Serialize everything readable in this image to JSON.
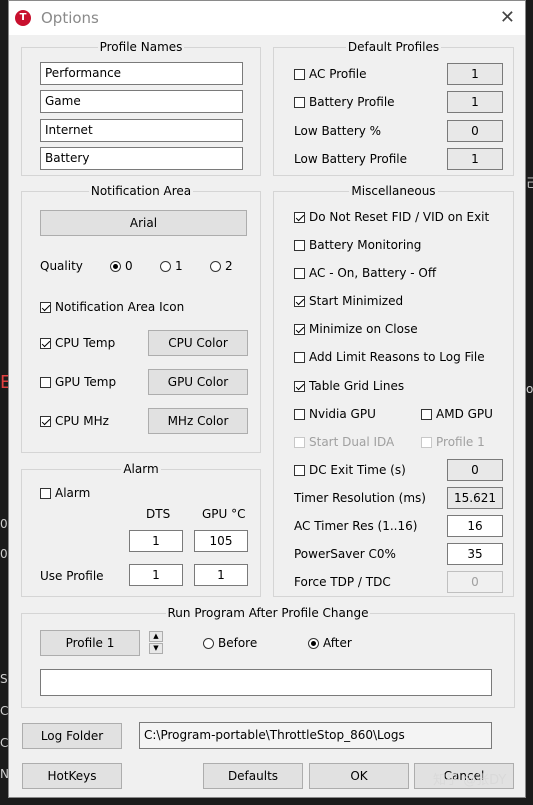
{
  "background_text": [
    "己",
    "E",
    "on",
    "0",
    "0",
    "S",
    "C",
    "C",
    "N"
  ],
  "window": {
    "title": "Options",
    "app_icon": "T",
    "close_icon": "✕"
  },
  "profile_names": {
    "title": "Profile Names",
    "items": [
      "Performance",
      "Game",
      "Internet",
      "Battery"
    ]
  },
  "default_profiles": {
    "title": "Default Profiles",
    "ac_profile": {
      "label": "AC Profile",
      "checked": false,
      "value": "1"
    },
    "battery_profile": {
      "label": "Battery Profile",
      "checked": false,
      "value": "1"
    },
    "low_battery_pct": {
      "label": "Low Battery %",
      "value": "0"
    },
    "low_battery_profile": {
      "label": "Low Battery Profile",
      "value": "1"
    }
  },
  "notification_area": {
    "title": "Notification Area",
    "font_button": "Arial",
    "quality_label": "Quality",
    "quality_options": [
      "0",
      "1",
      "2"
    ],
    "quality_selected": "0",
    "icon_checkbox": {
      "label": "Notification Area Icon",
      "checked": true
    },
    "cpu_temp": {
      "label": "CPU Temp",
      "checked": true,
      "button": "CPU Color"
    },
    "gpu_temp": {
      "label": "GPU Temp",
      "checked": false,
      "button": "GPU Color"
    },
    "cpu_mhz": {
      "label": "CPU MHz",
      "checked": true,
      "button": "MHz Color"
    }
  },
  "alarm": {
    "title": "Alarm",
    "alarm_checkbox": {
      "label": "Alarm",
      "checked": false
    },
    "col_dts": "DTS",
    "col_gpu": "GPU °C",
    "dts_value": "1",
    "gpu_value": "105",
    "use_profile_label": "Use Profile",
    "use_profile_dts": "1",
    "use_profile_gpu": "1"
  },
  "misc": {
    "title": "Miscellaneous",
    "checks": [
      {
        "label": "Do Not Reset FID / VID on Exit",
        "checked": true
      },
      {
        "label": "Battery Monitoring",
        "checked": false
      },
      {
        "label": "AC - On, Battery - Off",
        "checked": false
      },
      {
        "label": "Start Minimized",
        "checked": true
      },
      {
        "label": "Minimize on Close",
        "checked": true
      },
      {
        "label": "Add Limit Reasons to Log File",
        "checked": false
      },
      {
        "label": "Table Grid Lines",
        "checked": true
      }
    ],
    "nvidia_gpu": {
      "label": "Nvidia GPU",
      "checked": false
    },
    "amd_gpu": {
      "label": "AMD GPU",
      "checked": false
    },
    "start_dual_ida": {
      "label": "Start Dual IDA",
      "checked": false
    },
    "profile_1": {
      "label": "Profile 1",
      "checked": false
    },
    "dc_exit_time": {
      "label": "DC Exit Time (s)",
      "checked": false,
      "value": "0"
    },
    "timer_resolution": {
      "label": "Timer Resolution (ms)",
      "value": "15.621"
    },
    "ac_timer_res": {
      "label": "AC Timer Res (1..16)",
      "value": "16"
    },
    "powersaver": {
      "label": "PowerSaver C0%",
      "value": "35"
    },
    "force_tdp": {
      "label": "Force TDP / TDC",
      "value": "0"
    }
  },
  "run_program": {
    "title": "Run Program After Profile Change",
    "profile_button": "Profile 1",
    "spin_up": "▲",
    "spin_down": "▼",
    "before_label": "Before",
    "after_label": "After",
    "selected": "After",
    "path_value": ""
  },
  "log_folder": {
    "button": "Log Folder",
    "path": "C:\\Program-portable\\ThrottleStop_860\\Logs"
  },
  "bottom": {
    "hotkeys": "HotKeys",
    "defaults": "Defaults",
    "ok": "OK",
    "cancel": "Cancel"
  },
  "watermark": "知乎 @张DY"
}
